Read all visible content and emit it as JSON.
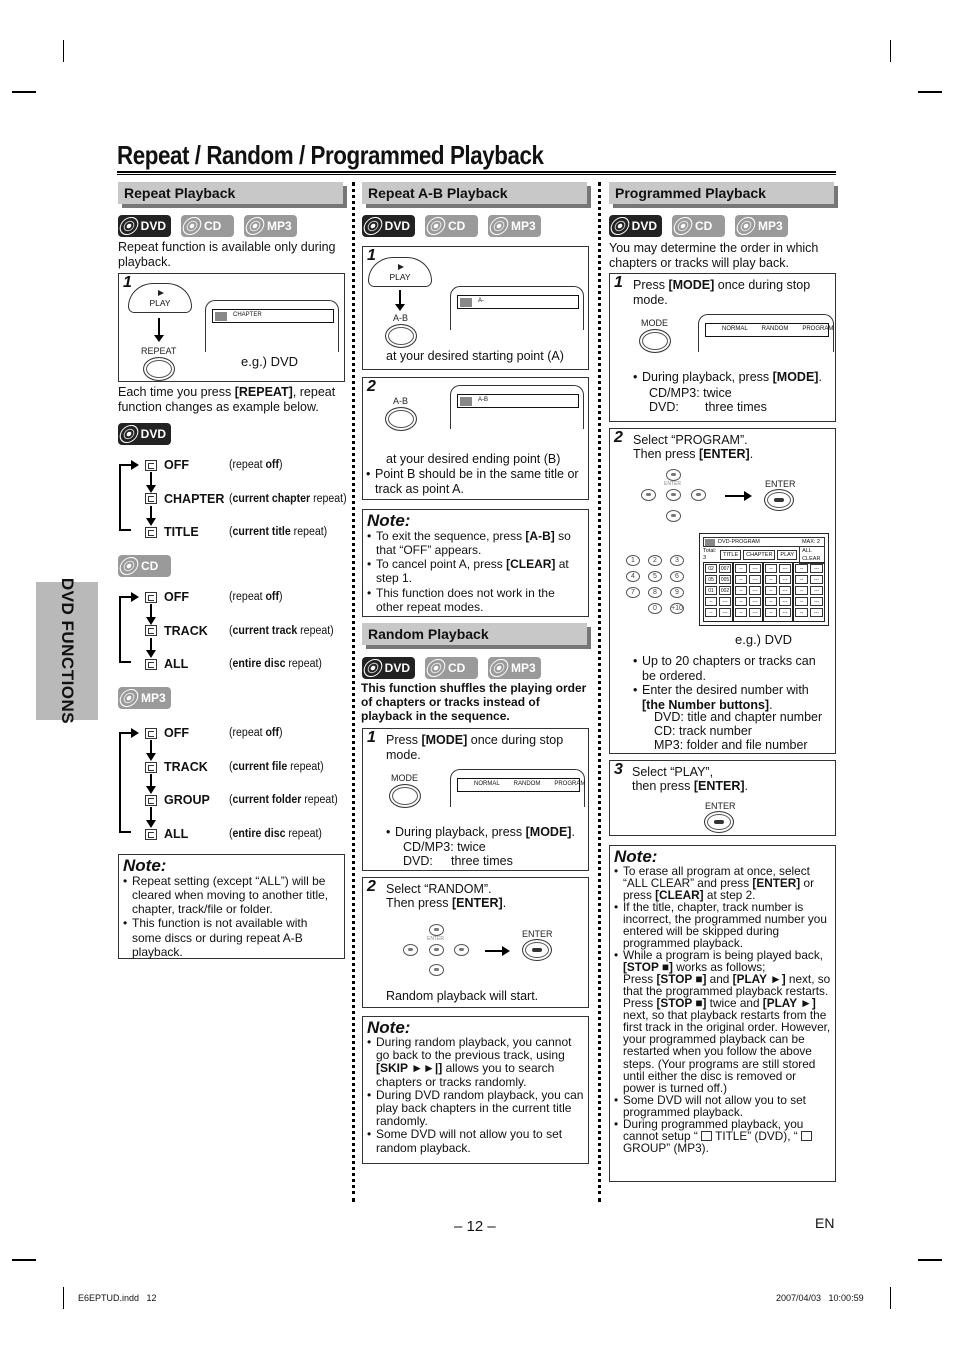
{
  "page": {
    "title": "Repeat / Random / Programmed Playback",
    "side_tab": "DVD FUNCTIONS",
    "page_number": "– 12 –",
    "language": "EN",
    "footer_file": "E6EPTUD.indd   12",
    "footer_timestamp": "2007/04/03   10:00:59"
  },
  "badges": {
    "dvd": "DVD",
    "cd": "CD",
    "mp3": "MP3"
  },
  "repeat": {
    "header": "Repeat Playback",
    "intro": "Repeat function is available only during playback.",
    "step1": {
      "num": "1",
      "play_label": "PLAY",
      "repeat_label": "REPEAT",
      "screen_text": "CHAPTER",
      "caption": "e.g.) DVD"
    },
    "each_time": {
      "pre": "Each time you press ",
      "bold": "[REPEAT]",
      "post": ", repeat function changes as example below."
    },
    "dvd_chain": [
      {
        "label": "OFF",
        "desc_pre": "(repeat ",
        "desc_bold": "off",
        "desc_post": ")"
      },
      {
        "label": "CHAPTER",
        "desc_pre": "(",
        "desc_bold": "current chapter",
        "desc_post": " repeat)"
      },
      {
        "label": "TITLE",
        "desc_pre": "(",
        "desc_bold": "current title",
        "desc_post": " repeat)"
      }
    ],
    "cd_chain": [
      {
        "label": "OFF",
        "desc_pre": "(repeat ",
        "desc_bold": "off",
        "desc_post": ")"
      },
      {
        "label": "TRACK",
        "desc_pre": "(",
        "desc_bold": "current track",
        "desc_post": " repeat)"
      },
      {
        "label": "ALL",
        "desc_pre": "(",
        "desc_bold": "entire disc",
        "desc_post": " repeat)"
      }
    ],
    "mp3_chain": [
      {
        "label": "OFF",
        "desc_pre": "(repeat ",
        "desc_bold": "off",
        "desc_post": ")"
      },
      {
        "label": "TRACK",
        "desc_pre": "(",
        "desc_bold": "current file",
        "desc_post": " repeat)"
      },
      {
        "label": "GROUP",
        "desc_pre": "(",
        "desc_bold": "current folder",
        "desc_post": " repeat)"
      },
      {
        "label": "ALL",
        "desc_pre": "(",
        "desc_bold": "entire disc",
        "desc_post": " repeat)"
      }
    ],
    "note": {
      "title": "Note:",
      "items": [
        "Repeat setting (except “ALL”) will be cleared when moving to another title, chapter, track/file or folder.",
        "This function is not available with some discs or during repeat A-B playback."
      ]
    }
  },
  "ab": {
    "header": "Repeat A-B Playback",
    "step1": {
      "num": "1",
      "play_label": "PLAY",
      "ab_label": "A-B",
      "screen_text": "A-",
      "caption": "at your desired starting point (A)"
    },
    "step2": {
      "num": "2",
      "ab_label": "A-B",
      "screen_text": "A-B",
      "caption": "at your desired ending point (B)",
      "bullet": "Point B should be in the same title or track as point A."
    },
    "note": {
      "title": "Note:",
      "items": [
        {
          "pre": "To exit the sequence, press ",
          "bold": "[A-B]",
          "post": " so that “OFF” appears."
        },
        {
          "pre": "To cancel point A, press ",
          "bold": "[CLEAR]",
          "post": " at step 1."
        },
        {
          "pre": "This function does not work in the other repeat modes.",
          "bold": "",
          "post": ""
        }
      ]
    }
  },
  "random": {
    "header": "Random Playback",
    "intro": "This function shuffles the playing order of chapters or tracks instead of playback in the sequence.",
    "step1": {
      "num": "1",
      "text_pre": "Press ",
      "text_bold": "[MODE]",
      "text_post": " once during stop mode.",
      "mode_label": "MODE",
      "screen_items": [
        "NORMAL",
        "RANDOM",
        "PROGRAM"
      ],
      "bullet_pre": "During playback, press ",
      "bullet_bold": "[MODE]",
      "bullet_post": ".",
      "cdmp3": "CD/MP3: twice",
      "dvd_key": "DVD:",
      "dvd_val": "three times"
    },
    "step2": {
      "num": "2",
      "line1": "Select “RANDOM”.",
      "line2_pre": "Then press ",
      "line2_bold": "[ENTER]",
      "line2_post": ".",
      "enter_small": "ENTER",
      "enter_label": "ENTER",
      "caption": "Random playback will start."
    },
    "note": {
      "title": "Note:",
      "items": [
        {
          "pre": "During random playback, you cannot go back to the previous track, using ",
          "bold": "[SKIP ►►|]",
          "post": " allows you to search chapters or tracks randomly."
        },
        {
          "pre": "During DVD random playback, you can play back chapters in the current title randomly.",
          "bold": "",
          "post": ""
        },
        {
          "pre": "Some DVD will not allow you to set random playback.",
          "bold": "",
          "post": ""
        }
      ]
    }
  },
  "program": {
    "header": "Programmed Playback",
    "intro": "You may determine the order in which chapters or tracks will play back.",
    "step1": {
      "num": "1",
      "text_pre": "Press ",
      "text_bold": "[MODE]",
      "text_post": " once during stop mode.",
      "mode_label": "MODE",
      "screen_items": [
        "NORMAL",
        "RANDOM",
        "PROGRAM"
      ],
      "bullet_pre": "During playback, press ",
      "bullet_bold": "[MODE]",
      "bullet_post": ".",
      "cdmp3": "CD/MP3: twice",
      "dvd_key": "DVD:",
      "dvd_val": "three times"
    },
    "step2": {
      "num": "2",
      "line1": "Select “PROGRAM”.",
      "line2_pre": "Then press ",
      "line2_bold": "[ENTER]",
      "line2_post": ".",
      "enter_small": "ENTER",
      "enter_label": "ENTER",
      "numpad": [
        "1",
        "2",
        "3",
        "4",
        "5",
        "6",
        "7",
        "8",
        "9",
        "0",
        "+10"
      ],
      "screen": {
        "title": "DVD-PROGRAM",
        "max": "MAX:   2",
        "total": "Total:  3",
        "buttons": [
          "TITLE",
          "CHAPTER",
          "PLAY",
          "ALL CLEAR"
        ],
        "entries": [
          [
            "02",
            "007"
          ],
          [
            "05",
            "005"
          ],
          [
            "01",
            "002"
          ],
          [
            "--",
            "---"
          ],
          [
            "--",
            "---"
          ]
        ],
        "empty": [
          "--",
          "---"
        ]
      },
      "caption": "e.g.) DVD",
      "bullets": [
        {
          "pre": "Up to 20 chapters or tracks can be ordered.",
          "bold": "",
          "post": ""
        },
        {
          "pre": "Enter the desired number with ",
          "bold": "[the Number buttons]",
          "post": "."
        }
      ],
      "dvd_line": "DVD: title and chapter number",
      "cd_line": "CD:   track number",
      "mp3_line": "MP3: folder and file number"
    },
    "step3": {
      "num": "3",
      "line1": "Select “PLAY”,",
      "line2_pre": "then press ",
      "line2_bold": "[ENTER]",
      "line2_post": ".",
      "enter_label": "ENTER"
    },
    "note": {
      "title": "Note:",
      "html_items": [
        "To erase all program at once, select “ALL CLEAR” and press <b>[ENTER]</b> or press <b>[CLEAR]</b> at step 2.",
        "If the title, chapter, track number is incorrect, the programmed number you entered will be skipped during programmed playback.",
        "While a program is being played back, <b>[STOP ■]</b> works as follows;<br>Press <b>[STOP ■]</b> and <b>[PLAY ►]</b> next, so that the programmed playback restarts.<br>Press <b>[STOP ■]</b> twice and <b>[PLAY ►]</b> next, so that playback restarts from the first track in the original order. However, your programmed playback can be restarted when you follow the above steps. (Your programs are still stored until either the disc is removed or power is turned off.)",
        "Some DVD will not allow you to set programmed playback.",
        "During programmed playback, you cannot setup “ <span class='rep-inline'></span> TITLE” (DVD), “ <span class='rep-inline'></span> GROUP” (MP3)."
      ]
    }
  }
}
